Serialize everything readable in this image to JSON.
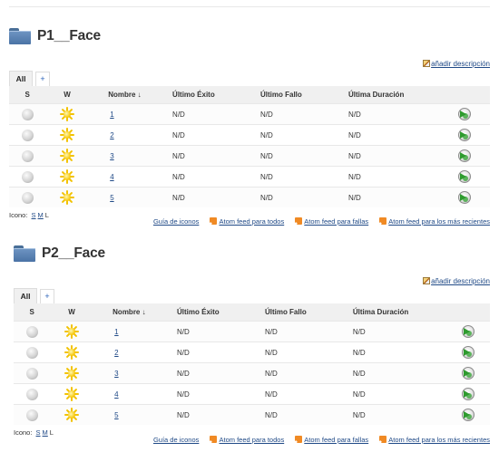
{
  "sections": [
    {
      "title": "P1__Face",
      "add_description": "añadir descripción",
      "tabs": {
        "all": "All",
        "add": "+"
      },
      "columns": {
        "s": "S",
        "w": "W",
        "name": "Nombre",
        "sort_arrow": "↓",
        "last_success": "Último Éxito",
        "last_failure": "Último Fallo",
        "last_duration": "Última Duración"
      },
      "rows": [
        {
          "name": "1",
          "last_success": "N/D",
          "last_failure": "N/D",
          "last_duration": "N/D"
        },
        {
          "name": "2",
          "last_success": "N/D",
          "last_failure": "N/D",
          "last_duration": "N/D"
        },
        {
          "name": "3",
          "last_success": "N/D",
          "last_failure": "N/D",
          "last_duration": "N/D"
        },
        {
          "name": "4",
          "last_success": "N/D",
          "last_failure": "N/D",
          "last_duration": "N/D"
        },
        {
          "name": "5",
          "last_success": "N/D",
          "last_failure": "N/D",
          "last_duration": "N/D"
        }
      ],
      "icon_label": "Icono:",
      "icon_sizes": [
        "S",
        "M",
        "L"
      ],
      "links": {
        "legend": "Guía de iconos",
        "feed_all": "Atom feed para todos",
        "feed_failures": "Atom feed para fallas",
        "feed_recent": "Atom feed para los más recientes"
      }
    },
    {
      "title": "P2__Face",
      "add_description": "añadir descripción",
      "tabs": {
        "all": "All",
        "add": "+"
      },
      "columns": {
        "s": "S",
        "w": "W",
        "name": "Nombre",
        "sort_arrow": "↓",
        "last_success": "Último Éxito",
        "last_failure": "Último Fallo",
        "last_duration": "Última Duración"
      },
      "rows": [
        {
          "name": "1",
          "last_success": "N/D",
          "last_failure": "N/D",
          "last_duration": "N/D"
        },
        {
          "name": "2",
          "last_success": "N/D",
          "last_failure": "N/D",
          "last_duration": "N/D"
        },
        {
          "name": "3",
          "last_success": "N/D",
          "last_failure": "N/D",
          "last_duration": "N/D"
        },
        {
          "name": "4",
          "last_success": "N/D",
          "last_failure": "N/D",
          "last_duration": "N/D"
        },
        {
          "name": "5",
          "last_success": "N/D",
          "last_failure": "N/D",
          "last_duration": "N/D"
        }
      ],
      "icon_label": "Icono:",
      "icon_sizes": [
        "S",
        "M",
        "L"
      ],
      "links": {
        "legend": "Guía de iconos",
        "feed_all": "Atom feed para todos",
        "feed_failures": "Atom feed para fallas",
        "feed_recent": "Atom feed para los más recientes"
      }
    }
  ],
  "icons": {
    "status": "grey-ball-icon",
    "weather": "sun-icon",
    "build": "schedule-build-icon",
    "folder": "folder-icon",
    "edit": "edit-pencil-icon",
    "feed": "rss-feed-icon"
  },
  "colors": {
    "link": "#204a87",
    "header_bg": "#f0f0f0",
    "folder": "#5a82b4",
    "rss": "#f08a24",
    "sun": "#f5c400"
  }
}
